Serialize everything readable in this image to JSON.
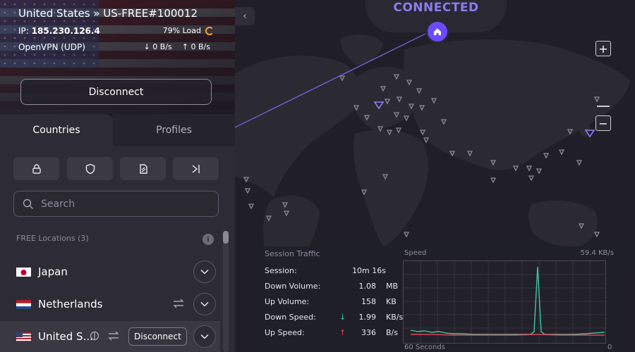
{
  "header": {
    "server_title": "United States » US-FREE#100012",
    "ip_label": "IP:",
    "ip_value": "185.230.126.4",
    "load": "79% Load",
    "protocol": "OpenVPN (UDP)",
    "down_rate": "↓ 0 B/s",
    "up_rate": "↑ 0 B/s",
    "disconnect_label": "Disconnect"
  },
  "tabs": {
    "countries": "Countries",
    "profiles": "Profiles"
  },
  "filters": {
    "icons": [
      "lock-icon",
      "shield-icon",
      "p2p-icon",
      "tor-icon"
    ]
  },
  "search": {
    "placeholder": "Search"
  },
  "locations": {
    "group_label": "FREE Locations (3)",
    "info_icon": "i",
    "items": [
      {
        "name": "Japan",
        "flag": "jp"
      },
      {
        "name": "Netherlands",
        "flag": "nl"
      },
      {
        "name": "United S...",
        "flag": "us",
        "active": true,
        "action": "Disconnect"
      }
    ]
  },
  "map": {
    "status": "CONNECTED",
    "collapse_icon": "‹",
    "zoom_in": "+",
    "zoom_out": "−"
  },
  "traffic": {
    "title": "Session Traffic",
    "stats": [
      {
        "label": "Session:",
        "value": "10m 16s",
        "unit": ""
      },
      {
        "label": "Down Volume:",
        "value": "1.08",
        "unit": "MB"
      },
      {
        "label": "Up Volume:",
        "value": "158",
        "unit": "KB"
      },
      {
        "label": "Down Speed:",
        "value": "1.99",
        "unit": "KB/s",
        "arrow": "↓"
      },
      {
        "label": "Up Speed:",
        "value": "336",
        "unit": "B/s",
        "arrow": "↑"
      }
    ],
    "speed_title": "Speed",
    "speed_max": "59.4 KB/s",
    "axis_left": "60 Seconds",
    "axis_right": "0"
  },
  "colors": {
    "accent": "#6d4aff",
    "connected": "#8a7cf0",
    "down_line": "#3ec8a0",
    "up_line": "#e0455a",
    "load_ring": "#f4a52a"
  }
}
